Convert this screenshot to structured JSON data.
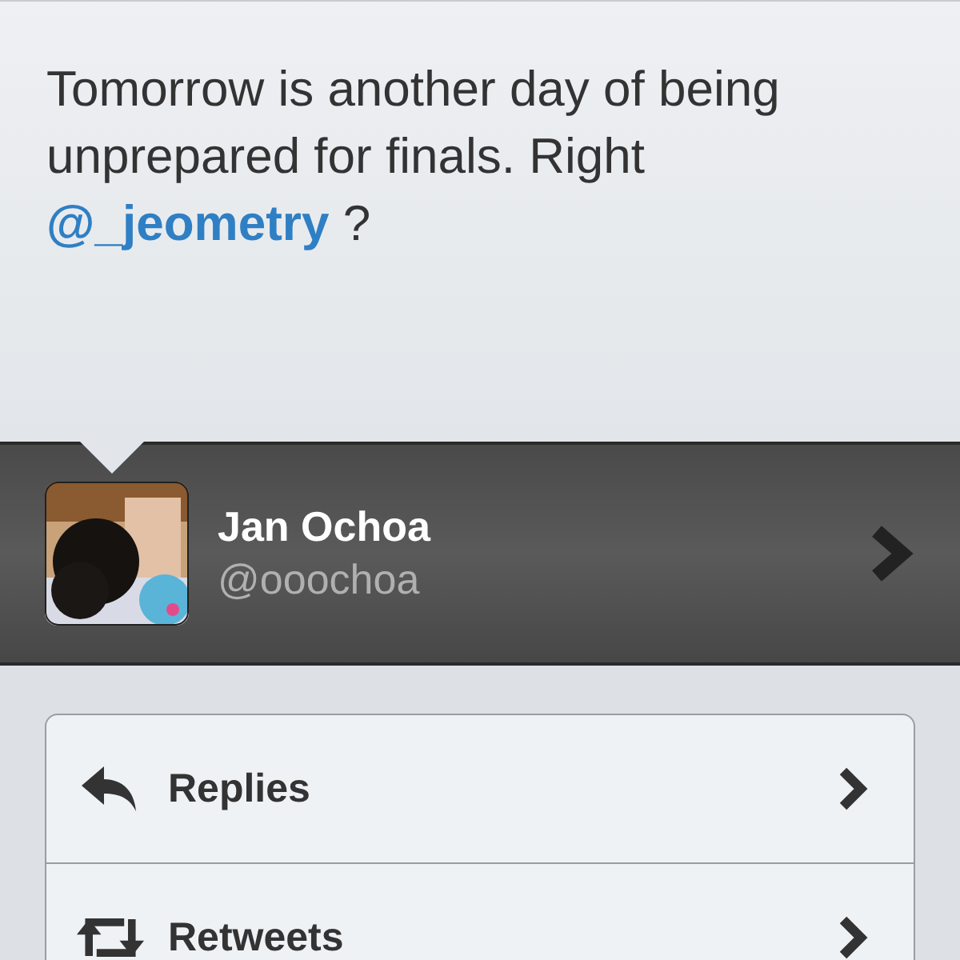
{
  "tweet": {
    "text": "Tomorrow is another day of being unprepared for finals. Right",
    "mention": "@_jeometry",
    "suffix": "?"
  },
  "author": {
    "name": "Jan Ochoa",
    "handle": "@ooochoa"
  },
  "rows": [
    {
      "kind": "replies",
      "label": "Replies"
    },
    {
      "kind": "retweets",
      "label": "Retweets"
    }
  ]
}
